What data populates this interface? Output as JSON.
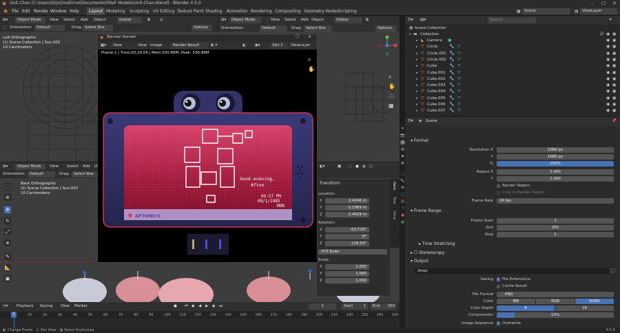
{
  "window": {
    "title": "Unit-Chan [C:\\Users\\tkjs\\OneDrive\\Documents\\FNaF Models\\Unit-Chan.blend] - Blender 4.5.0"
  },
  "menu": [
    "File",
    "Edit",
    "Render",
    "Window",
    "Help"
  ],
  "workspaces": [
    "Layout",
    "Modeling",
    "Sculpting",
    "UV Editing",
    "Texture Paint",
    "Shading",
    "Animation",
    "Rendering",
    "Compositing",
    "Geometry Nodes",
    "Scripting"
  ],
  "scene_name": "Scene",
  "view_layer": "ViewLayer",
  "top_viewport": {
    "mode": "Object Mode",
    "menus": [
      "View",
      "Select",
      "Add",
      "Object"
    ],
    "transform": "Global",
    "orientation_label": "Orientation:",
    "orientation": "Default",
    "drag_label": "Drag:",
    "drag": "Select Box",
    "options": "Options",
    "info": [
      "Left Orthographic",
      "(1) Scene Collection | Sun.002",
      "10 Centimeters"
    ]
  },
  "mid_viewport": {
    "mode": "Object Mode",
    "menus": [
      "View",
      "Select",
      "Add",
      "Object"
    ],
    "transform": "Global",
    "orientation_label": "Orientation:",
    "orientation": "Default",
    "drag_label": "Drag:",
    "drag": "Select Box",
    "options": "Options"
  },
  "bottom_viewport": {
    "mode": "Object Mode",
    "menus": [
      "View",
      "Select",
      "Add",
      "Object"
    ],
    "orientation_label": "Orientation:",
    "orientation": "Default",
    "drag_label": "Drag:",
    "drag": "Select Box",
    "info": [
      "Back Orthographic",
      "(1) Scene Collection | Sun.002",
      "10 Centimeters"
    ],
    "sidebar_tabs": [
      "Item",
      "Tool",
      "View"
    ],
    "transform_title": "Transform",
    "location_label": "Location:",
    "location": [
      "2.4246 m",
      "-3.1969 m",
      "2.4629 m"
    ],
    "rotation_label": "Rotation:",
    "rotation": [
      "-53.719°",
      "0°",
      "-139.54°"
    ],
    "rotation_mode": "XYZ Euler",
    "scale_label": "Scale:",
    "scale": [
      "1.000",
      "1.000",
      "1.000"
    ],
    "axes": [
      "X",
      "Y",
      "Z"
    ]
  },
  "render_window": {
    "title": "Blender Render",
    "menus": [
      "View",
      "View",
      "Image"
    ],
    "image_name": "Render Result",
    "slot": "Slot 1",
    "view_layer": "ViewLayer",
    "stats": "Frame:1 | Time:00:29.04 | Mem:530.86M, Peak: 530.86M",
    "screen_text": [
      "Good-evening,",
      "Afton."
    ],
    "clock": "09:57 PM",
    "date": "09/1/1985",
    "day": "MON",
    "brand": "AFTONICS"
  },
  "outliner": {
    "search_placeholder": "Search",
    "root": "Scene Collection",
    "collection": "Collection",
    "items": [
      "Camera",
      "Circle",
      "Circle.001",
      "Circle.002",
      "Cube",
      "Cube.001",
      "Cube.002",
      "Cube.003",
      "Cube.004",
      "Cube.005",
      "Cube.006",
      "Cube.007"
    ]
  },
  "properties": {
    "breadcrumb": "Scene",
    "format_section": "Format",
    "resolution_x_label": "Resolution X",
    "resolution_x": "1080 px",
    "y_label": "Y",
    "resolution_y": "1080 px",
    "percent_label": "%",
    "resolution_pct": "100%",
    "aspect_x_label": "Aspect X",
    "aspect_x": "1.000",
    "aspect_y": "1.000",
    "render_region": "Render Region",
    "crop_region": "Crop to Render Region",
    "frame_rate_label": "Frame Rate",
    "frame_rate": "24 fps",
    "frame_range_section": "Frame Range",
    "frame_start_label": "Frame Start",
    "frame_start": "1",
    "end_label": "End",
    "frame_end": "250",
    "step_label": "Step",
    "frame_step": "1",
    "time_stretching": "Time Stretching",
    "stereoscopy": "Stereoscopy",
    "output_section": "Output",
    "output_path": "/tmp\\",
    "saving_label": "Saving",
    "file_extensions": "File Extensions",
    "cache_result": "Cache Result",
    "file_format_label": "File Format",
    "file_format": "PNG",
    "color_label": "Color",
    "color_options": [
      "BW",
      "RGB",
      "RGBA"
    ],
    "color_depth_label": "Color Depth",
    "color_depth_options": [
      "8",
      "16"
    ],
    "compression_label": "Compression",
    "compression": "15%",
    "compression_value": 0.15,
    "image_sequence_label": "Image Sequence",
    "overwrite": "Overwrite"
  },
  "timeline": {
    "menus": [
      "Playback",
      "Keying",
      "View",
      "Marker"
    ],
    "current_frame": "1",
    "start_label": "Start",
    "start": "1",
    "end_label": "End",
    "end": "250",
    "ticks": [
      "1",
      "10",
      "20",
      "30",
      "40",
      "50",
      "60",
      "70",
      "80",
      "90",
      "100",
      "110",
      "120",
      "130",
      "140",
      "150",
      "160",
      "170",
      "180",
      "190",
      "200",
      "210",
      "220",
      "230",
      "240",
      "250"
    ]
  },
  "status": {
    "items": [
      "Change Frame",
      "Pan View",
      "Select Keyframes"
    ],
    "version": "4.5.0"
  },
  "colors": {
    "accent": "#4772b3",
    "orange": "#e8833a",
    "header": "#303030",
    "viewport": "#3d3d3d"
  }
}
